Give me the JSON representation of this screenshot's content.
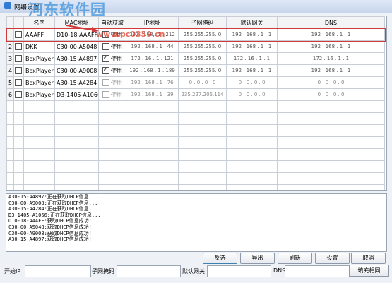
{
  "window": {
    "title": "网络设置"
  },
  "watermark": {
    "main": "河东软件园",
    "url": "www.pc0359.cn"
  },
  "table": {
    "headers": [
      "",
      "",
      "名字",
      "MAC地址",
      "自动获取",
      "IP地址",
      "子网掩码",
      "默认网关",
      "DNS"
    ],
    "rows": [
      {
        "num": "",
        "checked": false,
        "name": "AAAFF",
        "mac": "D10-18-AAAFF",
        "auto": false,
        "auto_label": "使用",
        "ip": "192 . 168 . 1 . 212",
        "mask": "255.255.255. 0",
        "gw": "192 . 168 . 1 . 1",
        "dns": "192 . 168 . 1 . 1",
        "selected": true
      },
      {
        "num": "2",
        "checked": false,
        "name": "DKK",
        "mac": "C30-00-A5048",
        "auto": false,
        "auto_label": "使用",
        "ip": "192 . 168 . 1 . 44",
        "mask": "255.255.255. 0",
        "gw": "192 . 168 . 1 . 1",
        "dns": "192 . 168 . 1 . 1"
      },
      {
        "num": "3",
        "checked": false,
        "name": "BoxPlayer",
        "mac": "A30-15-A4897",
        "auto": true,
        "auto_label": "使用",
        "ip": "172 . 16 . 1 . 121",
        "mask": "255.255.255. 0",
        "gw": "172 . 16 . 1 . 1",
        "dns": "172 . 16 . 1 . 1"
      },
      {
        "num": "4",
        "checked": false,
        "name": "BoxPlayer",
        "mac": "C30-00-A9008",
        "auto": true,
        "auto_label": "使用",
        "ip": "192 . 168 . 1 . 189",
        "mask": "255.255.255. 0",
        "gw": "192 . 168 . 1 . 1",
        "dns": "192 . 168 . 1 . 1"
      },
      {
        "num": "5",
        "checked": false,
        "name": "BoxPlayer",
        "mac": "A30-15-A4284",
        "auto": false,
        "auto_label": "使用",
        "ip": "192 . 168 . 1 . 76",
        "mask": "0 . 0 . 0 . 0",
        "gw": "0 . 0 . 0 . 0",
        "dns": "0 . 0 . 0 . 0",
        "gray": true
      },
      {
        "num": "6",
        "checked": false,
        "name": "BoxPlayer",
        "mac": "D3-1405-A1066",
        "auto": false,
        "auto_label": "使用",
        "ip": "192 . 168 . 1 . 39",
        "mask": "235.227.206.114",
        "gw": "0 . 0 . 0 . 0",
        "dns": "0 . 0 . 0 . 0",
        "gray": true
      }
    ]
  },
  "log": [
    "A30-15-A4897:正在获取DHCP信息...",
    "C30-00-A9008:正在获取DHCP信息...",
    "A30-15-A4284:正在获取DHCP信息...",
    "D3-1405-A1066:正在获取DHCP信息...",
    "D10-18-AAAFF:获取DHCP信息成功!",
    "C30-00-A5048:获取DHCP信息成功!",
    "C30-00-A9008:获取DHCP信息成功!",
    "A30-15-A4897:获取DHCP信息成功!"
  ],
  "buttons": {
    "invert": "反选",
    "export": "导出",
    "refresh": "刷新",
    "settings": "设置",
    "cancel": "取消"
  },
  "form": {
    "start_ip_label": "开始IP",
    "start_ip_value": "",
    "mask_label": "子网掩码",
    "mask_value": "",
    "gateway_label": "默认网关",
    "gateway_value": "",
    "dns_label": "DNS",
    "dns_value": "",
    "fill_button": "填充相同"
  }
}
